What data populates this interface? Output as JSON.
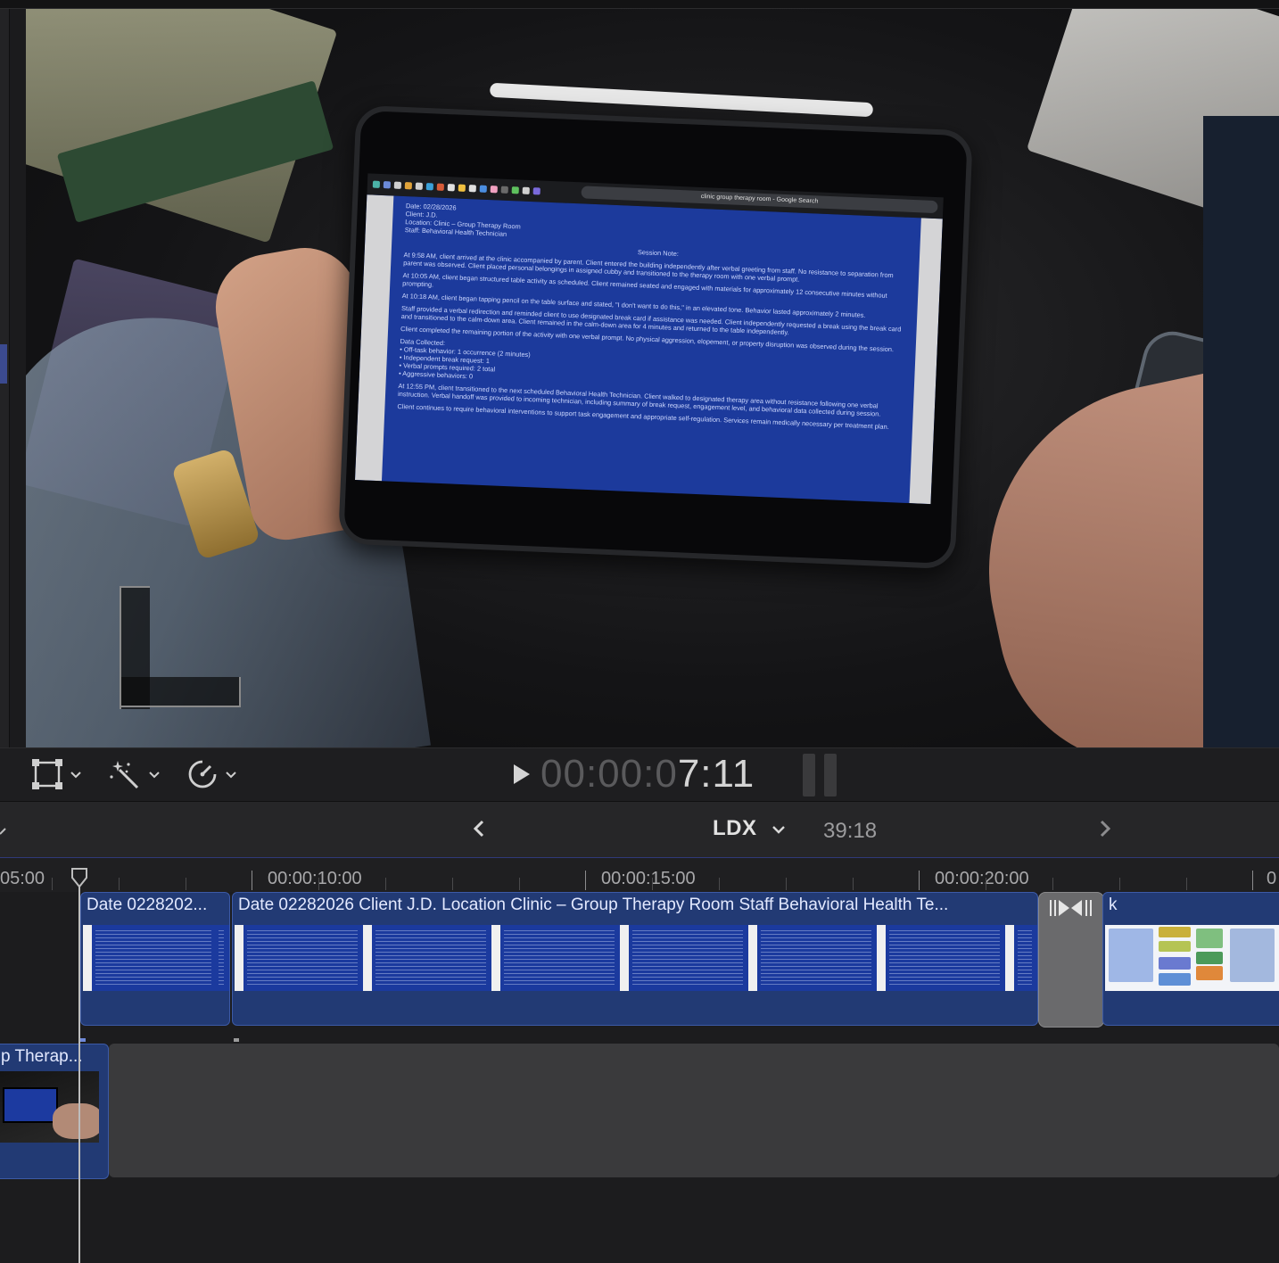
{
  "viewer": {
    "timecode_dim": "00:00:0",
    "timecode_bright": "7:11",
    "preview_document": {
      "browser_tab_title": "clinic group therapy room - Google Search",
      "header_lines": [
        "Date: 02/28/2026",
        "Client: J.D.",
        "Location: Clinic – Group Therapy Room",
        "Staff: Behavioral Health Technician"
      ],
      "section_title": "Session Note:",
      "paragraphs": [
        "At 9:58 AM, client arrived at the clinic accompanied by parent. Client entered the building independently after verbal greeting from staff. No resistance to separation from parent was observed. Client placed personal belongings in assigned cubby and transitioned to the therapy room with one verbal prompt.",
        "At 10:05 AM, client began structured table activity as scheduled. Client remained seated and engaged with materials for approximately 12 consecutive minutes without prompting.",
        "At 10:18 AM, client began tapping pencil on the table surface and stated, \"I don't want to do this,\" in an elevated tone. Behavior lasted approximately 2 minutes.",
        "Staff provided a verbal redirection and reminded client to use designated break card if assistance was needed. Client independently requested a break using the break card and transitioned to the calm-down area. Client remained in the calm-down area for 4 minutes and returned to the table independently.",
        "Client completed the remaining portion of the activity with one verbal prompt. No physical aggression, elopement, or property disruption was observed during the session."
      ],
      "data_title": "Data Collected:",
      "data_items": [
        "• Off-task behavior: 1 occurrence (2 minutes)",
        "• Independent break request: 1",
        "• Verbal prompts required: 2 total",
        "• Aggressive behaviors: 0"
      ],
      "closing_paragraphs": [
        "At 12:55 PM, client transitioned to the next scheduled Behavioral Health Technician. Client walked to designated therapy area without resistance following one verbal instruction. Verbal handoff was provided to incoming technician, including summary of break request, engagement level, and behavioral data collected during session.",
        "Client continues to require behavioral interventions to support task engagement and appropriate self-regulation. Services remain medically necessary per treatment plan."
      ]
    }
  },
  "toolbar": {
    "transform_icon": "crop-transform-icon",
    "enhance_icon": "magic-wand-icon",
    "speed_icon": "speedometer-icon",
    "play_icon": "play-icon"
  },
  "timeline_header": {
    "project_name": "LDX",
    "duration": "39:18"
  },
  "ruler": {
    "labels": [
      {
        "text": "05:00"
      },
      {
        "text": "00:00:10:00"
      },
      {
        "text": "00:00:15:00"
      },
      {
        "text": "00:00:20:00"
      },
      {
        "text": "0"
      }
    ]
  },
  "clips": {
    "clip_a_title": "Date 0228202...",
    "clip_b_title": "Date 02282026 Client J.D. Location Clinic – Group Therapy Room Staff Behavioral Health Te...",
    "clip_c_title": "k",
    "connected_clip_title": "p Therap..."
  },
  "colors": {
    "clip_blue": "#223a74",
    "accent_blue": "#3c5aa6",
    "transition_gray": "#6a6a6c"
  }
}
